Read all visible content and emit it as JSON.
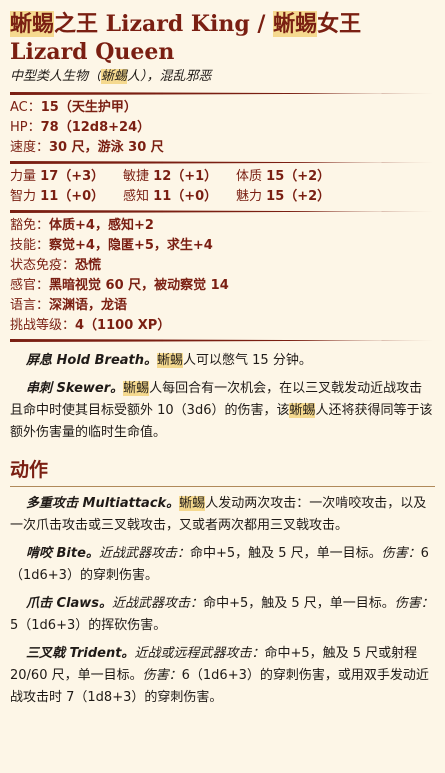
{
  "header": {
    "title_pre": "蜥蜴",
    "title_mid1": "之王 Lizard King / ",
    "title_hl2": "蜥蜴",
    "title_mid2": "女王",
    "title_line2": "Lizard Queen",
    "subtitle_pre": "中型类人生物（",
    "subtitle_hl": "蜥蜴",
    "subtitle_post": "人），混乱邪恶"
  },
  "stats": {
    "ac_label": "AC：",
    "ac_value": "15（天生护甲）",
    "hp_label": "HP：",
    "hp_value": "78（12d8+24）",
    "speed_label": "速度：",
    "speed_value": "30 尺，游泳 30 尺"
  },
  "abilities": [
    {
      "label": "力量",
      "value": "17（+3）"
    },
    {
      "label": "敏捷",
      "value": "12（+1）"
    },
    {
      "label": "体质",
      "value": "15（+2）"
    },
    {
      "label": "智力",
      "value": "11（+0）"
    },
    {
      "label": "感知",
      "value": "11（+0）"
    },
    {
      "label": "魅力",
      "value": "15（+2）"
    }
  ],
  "details": {
    "saves_label": "豁免：",
    "saves_value": "体质+4，感知+2",
    "skills_label": "技能：",
    "skills_value": "察觉+4，隐匿+5，求生+4",
    "cond_label": "状态免疫：",
    "cond_value": "恐慌",
    "senses_label": "感官：",
    "senses_value": "黑暗视觉 60 尺，被动察觉 14",
    "lang_label": "语言：",
    "lang_value": "深渊语，龙语",
    "cr_label": "挑战等级：",
    "cr_value": "4（1100 XP）"
  },
  "traits": {
    "hold_name": "屏息 Hold Breath。",
    "hold_hl": "蜥蜴",
    "hold_text": "人可以憋气 15 分钟。",
    "skewer_name": "串刺 Skewer。",
    "skewer_hl1": "蜥蜴",
    "skewer_text1": "人每回合有一次机会，在以三叉戟发动近战攻击且命中时使其目标受额外 10（3d6）的伤害，该",
    "skewer_hl2": "蜥蜴",
    "skewer_text2": "人还将获得同等于该额外伤害量的临时生命值。"
  },
  "actions": {
    "heading": "动作",
    "multi_name": "多重攻击 Multiattack。",
    "multi_hl": "蜥蜴",
    "multi_text": "人发动两次攻击：一次啃咬攻击，以及一次爪击攻击或三叉戟攻击，又或者两次都用三叉戟攻击。",
    "bite_name": "啃咬 Bite。",
    "bite_type": "近战武器攻击：",
    "bite_text": "命中+5，触及 5 尺，单一目标。",
    "bite_dmg_label": "伤害：",
    "bite_dmg": "6（1d6+3）的穿刺伤害。",
    "claw_name": "爪击 Claws。",
    "claw_type": "近战武器攻击：",
    "claw_text": "命中+5，触及 5 尺，单一目标。",
    "claw_dmg_label": "伤害：",
    "claw_dmg": "5（1d6+3）的挥砍伤害。",
    "trident_name": "三叉戟 Trident。",
    "trident_type": "近战或远程武器攻击：",
    "trident_text": "命中+5，触及 5 尺或射程 20/60 尺，单一目标。",
    "trident_dmg_label": "伤害：",
    "trident_dmg": "6（1d6+3）的穿刺伤害，或用双手发动近战攻击时 7（1d8+3）的穿刺伤害。"
  }
}
